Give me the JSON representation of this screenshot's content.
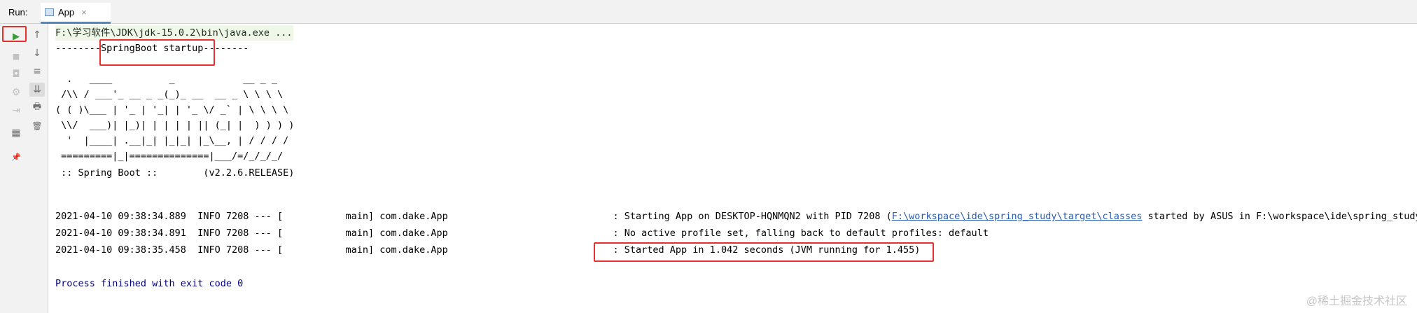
{
  "run_bar": {
    "label": "Run:",
    "tab_label": "App",
    "tab_close": "×"
  },
  "toolbar": {
    "rerun": "▶",
    "stop": "■",
    "camera": "◘",
    "layout": "⚙",
    "login": "⇥",
    "grid": "▦",
    "pin": "📌",
    "up": "↑",
    "down": "↓",
    "wrap": "≡",
    "scroll": "⇊",
    "print": "🖶",
    "trash": "🗑"
  },
  "console": {
    "command": "F:\\学习软件\\JDK\\jdk-15.0.2\\bin\\java.exe ...",
    "startup_banner": "--------SpringBoot startup--------",
    "ascii_art": [
      "  .   ____          _            __ _ _",
      " /\\\\ / ___'_ __ _ _(_)_ __  __ _ \\ \\ \\ \\",
      "( ( )\\___ | '_ | '_| | '_ \\/ _` | \\ \\ \\ \\",
      " \\\\/  ___)| |_)| | | | | || (_| |  ) ) ) )",
      "  '  |____| .__|_| |_|_| |_\\__, | / / / /",
      " =========|_|==============|___/=/_/_/_/",
      " :: Spring Boot ::        (v2.2.6.RELEASE)"
    ],
    "logs": [
      {
        "prefix": "2021-04-10 09:38:34.889  INFO 7208 --- [           main] com.dake.App                             : Starting App on DESKTOP-HQNMQN2 with PID 7208 (",
        "link": "F:\\workspace\\ide\\spring_study\\target\\classes",
        "suffix": " started by ASUS in F:\\workspace\\ide\\spring_study)"
      },
      {
        "prefix": "2021-04-10 09:38:34.891  INFO 7208 --- [           main] com.dake.App                             ",
        "message": ": No active profile set, falling back to default profiles: default"
      },
      {
        "prefix": "2021-04-10 09:38:35.458  INFO 7208 --- [           main] com.dake.App                             ",
        "message": ": Started App in 1.042 seconds (JVM running for 1.455)"
      }
    ],
    "exit_message": "Process finished with exit code 0"
  },
  "watermark": "@稀土掘金技术社区",
  "colors": {
    "highlight_red": "#e5302e",
    "link_blue": "#2a5db0",
    "run_green": "#3c9a3c"
  }
}
